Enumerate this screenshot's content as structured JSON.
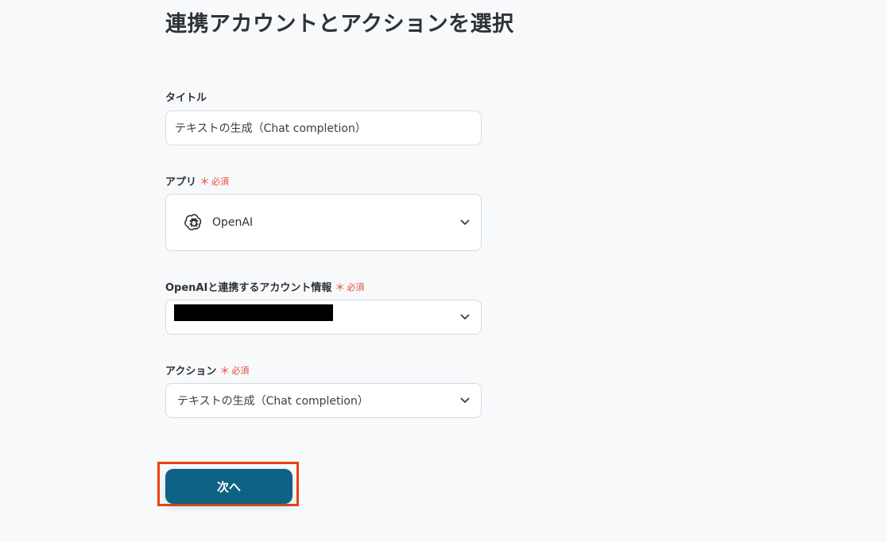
{
  "page": {
    "title": "連携アカウントとアクションを選択"
  },
  "form": {
    "title_field": {
      "label": "タイトル",
      "value": "テキストの生成（Chat completion）"
    },
    "app_field": {
      "label": "アプリ",
      "required_mark": "＊",
      "required_text": "必須",
      "value": "OpenAI",
      "icon": "openai-logo-icon"
    },
    "account_field": {
      "label": "OpenAIと連携するアカウント情報",
      "required_mark": "＊",
      "required_text": "必須"
    },
    "action_field": {
      "label": "アクション",
      "required_mark": "＊",
      "required_text": "必須",
      "value": "テキストの生成（Chat completion）"
    }
  },
  "actions": {
    "next_label": "次へ"
  },
  "colors": {
    "accent": "#0e6384",
    "required": "#e34b3a",
    "highlight": "#e8420e"
  }
}
